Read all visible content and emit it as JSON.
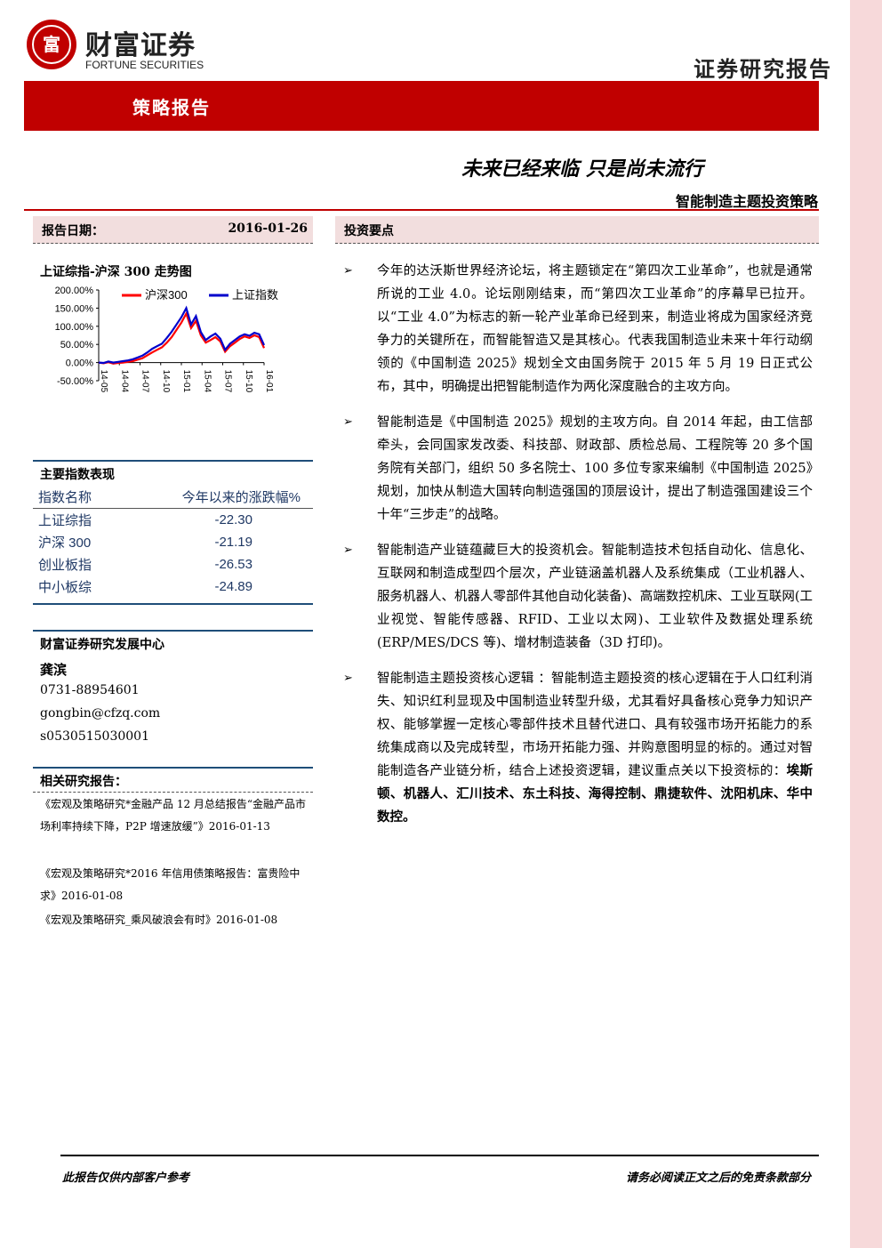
{
  "header": {
    "logo_glyph": "富",
    "brand_cn": "财富证券",
    "brand_en": "FORTUNE SECURITIES",
    "report_type": "证券研究报告",
    "banner_label": "策略报告"
  },
  "titles": {
    "main": "未来已经来临  只是尚未流行",
    "sub": "智能制造主题投资策略"
  },
  "meta": {
    "date_label": "报告日期：",
    "date_value": "2016-01-26",
    "highlights_label": "投资要点"
  },
  "chart_data": {
    "type": "line",
    "title": "上证综指-沪深 300 走势图",
    "x_ticks": [
      "14-05",
      "14-04",
      "14-07",
      "14-10",
      "15-01",
      "15-04",
      "15-07",
      "15-10",
      "16-01"
    ],
    "ylim": [
      -50,
      200
    ],
    "y_ticks": [
      "200.00%",
      "150.00%",
      "100.00%",
      "50.00%",
      "0.00%",
      "-50.00%"
    ],
    "grid": false,
    "legend_position": "top",
    "series": [
      {
        "name": "沪深300",
        "color": "#ff0000",
        "values": [
          0,
          -2,
          1,
          -3,
          -1,
          0,
          2,
          4,
          8,
          12,
          20,
          28,
          35,
          42,
          55,
          70,
          90,
          110,
          135,
          95,
          115,
          75,
          55,
          62,
          70,
          58,
          30,
          45,
          55,
          65,
          72,
          68,
          75,
          70,
          40
        ]
      },
      {
        "name": "上证指数",
        "color": "#0000cc",
        "values": [
          0,
          -1,
          3,
          0,
          2,
          4,
          6,
          9,
          14,
          19,
          28,
          38,
          45,
          52,
          68,
          85,
          105,
          125,
          150,
          105,
          128,
          84,
          62,
          72,
          80,
          66,
          35,
          52,
          62,
          72,
          78,
          74,
          82,
          78,
          48
        ]
      }
    ]
  },
  "index_table": {
    "title": "主要指数表现",
    "headers": [
      "指数名称",
      "今年以来的涨跌幅%"
    ],
    "rows": [
      {
        "name": "上证综指",
        "value": "-22.30"
      },
      {
        "name": "沪深 300",
        "value": "-21.19"
      },
      {
        "name": "创业板指",
        "value": "-26.53"
      },
      {
        "name": "中小板综",
        "value": "-24.89"
      }
    ]
  },
  "contact": {
    "dept": "财富证券研究发展中心",
    "analyst": "龚滨",
    "phone": "0731-88954601",
    "email": "gongbin@cfzq.com",
    "cert": "s0530515030001"
  },
  "related": {
    "title": "相关研究报告：",
    "items": [
      "《宏观及策略研究*金融产品 12 月总结报告“金融产品市场利率持续下降，P2P 增速放缓”》2016-01-13",
      "《宏观及策略研究*2016 年信用债策略报告：富贵险中求》2016-01-08",
      "《宏观及策略研究_乘风破浪会有时》2016-01-08"
    ]
  },
  "bullets": {
    "b1": "今年的达沃斯世界经济论坛，将主题锁定在“第四次工业革命”，也就是通常所说的工业 4.0。论坛刚刚结束，而“第四次工业革命”的序幕早已拉开。以“工业 4.0”为标志的新一轮产业革命已经到来，制造业将成为国家经济竞争力的关键所在，而智能智造又是其核心。代表我国制造业未来十年行动纲领的《中国制造 2025》规划全文由国务院于 2015 年 5 月 19 日正式公布，其中，明确提出把智能制造作为两化深度融合的主攻方向。",
    "b2": "智能制造是《中国制造 2025》规划的主攻方向。自 2014 年起，由工信部牵头，会同国家发改委、科技部、财政部、质检总局、工程院等 20 多个国务院有关部门，组织 50 多名院士、100 多位专家来编制《中国制造 2025》规划，加快从制造大国转向制造强国的顶层设计，提出了制造强国建设三个十年“三步走”的战略。",
    "b3": "智能制造产业链蕴藏巨大的投资机会。智能制造技术包括自动化、信息化、互联网和制造成型四个层次，产业链涵盖机器人及系统集成（工业机器人、服务机器人、机器人零部件其他自动化装备)、高端数控机床、工业互联网(工业视觉、智能传感器、RFID、工业以太网)、工业软件及数据处理系统(ERP/MES/DCS 等)、增材制造装备（3D 打印)。",
    "b4_text": "智能制造主题投资核心逻辑 ：智能制造主题投资的核心逻辑在于人口红利消失、知识红利显现及中国制造业转型升级，尤其看好具备核心竞争力知识产权、能够掌握一定核心零部件技术且替代进口、具有较强市场开拓能力的系统集成商以及完成转型，市场开拓能力强、并购意图明显的标的。通过对智能制造各产业链分析，结合上述投资逻辑，建议重点关以下投资标的：",
    "b4_bold": "埃斯顿、机器人、汇川技术、东土科技、海得控制、鼎捷软件、沈阳机床、华中数控。"
  },
  "footer": {
    "left": "此报告仅供内部客户参考",
    "right": "请务必阅读正文之后的免责条款部分"
  }
}
